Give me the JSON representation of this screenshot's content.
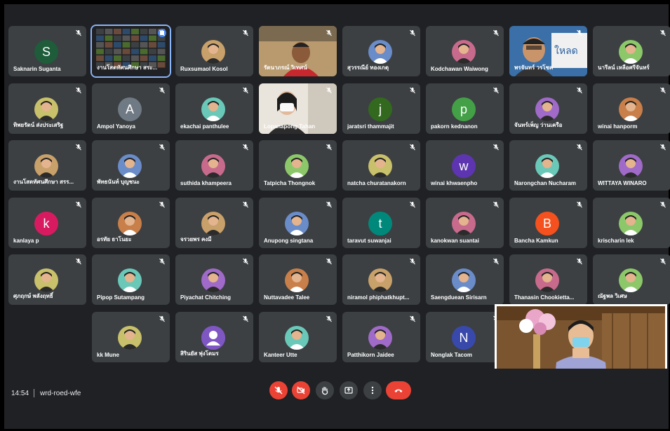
{
  "colors": {
    "background": "#202124",
    "tile": "#3c4043",
    "danger": "#ea4335",
    "active_border": "#8ab4f8"
  },
  "participants": [
    {
      "name": "Saknarin Suganta",
      "initial": "S",
      "avatar_color": "#1e5c3a"
    },
    {
      "name": "งานโสตทัศนศึกษา สระ...",
      "screen_share": true
    },
    {
      "name": "Ruxsumaol Kosol",
      "photo": true
    },
    {
      "name": "รัตนาภรณ์ วิเทศน์",
      "camera": true
    },
    {
      "name": "สุวรรณีย์ ทองเกตุ",
      "photo": true
    },
    {
      "name": "Kodchawan Waiwong",
      "photo": true
    },
    {
      "name": "พรจันทร์ วรโชค",
      "camera": true
    },
    {
      "name": "นารีลน์ เหลือศรีจันทร์",
      "photo": true
    },
    {
      "name": "ทิพยรัตน์ ส่งประเสริฐ",
      "photo": true
    },
    {
      "name": "Ampol Yanoya",
      "initial": "A",
      "avatar_color": "#6f7a84"
    },
    {
      "name": "ekachai panthulee",
      "photo": true
    },
    {
      "name": "Lopanapong Tahan",
      "camera": true
    },
    {
      "name": "jaratsri thammajit",
      "initial": "j",
      "avatar_color": "#33691e"
    },
    {
      "name": "pakorn kednanon",
      "initial": "p",
      "avatar_color": "#43a047"
    },
    {
      "name": "จันทร์เพ็ญ ว่านเครือ",
      "photo": true
    },
    {
      "name": "winai hanporm",
      "photo": true
    },
    {
      "name": "งานโสตทัศนศึกษา สรร...",
      "photo": true
    },
    {
      "name": "พัทธนันท์ บุญชนะ",
      "photo": true
    },
    {
      "name": "suthida khampeera",
      "photo": true
    },
    {
      "name": "Tatpicha Thongnok",
      "photo": true
    },
    {
      "name": "natcha churatanakorn",
      "photo": true
    },
    {
      "name": "winai khwaenpho",
      "initial": "w",
      "avatar_color": "#5e35b1"
    },
    {
      "name": "Narongchan Nucharam",
      "photo": true
    },
    {
      "name": "WITTAYA WINARO",
      "photo": true
    },
    {
      "name": "kanlaya p",
      "initial": "k",
      "avatar_color": "#d81b60"
    },
    {
      "name": "อรทัย ธาโนยะ",
      "photo": true
    },
    {
      "name": "จรวยพร คงมี",
      "photo": true
    },
    {
      "name": "Anupong singtana",
      "photo": true
    },
    {
      "name": "taravut suwanjai",
      "initial": "t",
      "avatar_color": "#00897b"
    },
    {
      "name": "kanokwan suantai",
      "photo": true
    },
    {
      "name": "Bancha Kamkun",
      "initial": "B",
      "avatar_color": "#f4511e"
    },
    {
      "name": "krischarin lek",
      "photo": true
    },
    {
      "name": "ศุภฤกษ์ พลังฤทธิ์",
      "photo": true
    },
    {
      "name": "Pipop Sutampang",
      "photo": true
    },
    {
      "name": "Piyachat Chitching",
      "photo": true
    },
    {
      "name": "Nuttavadee Talee",
      "photo": true
    },
    {
      "name": "niramol phiphatkhupt...",
      "photo": true
    },
    {
      "name": "Saengduean Sirisarn",
      "photo": true
    },
    {
      "name": "Thanasin Chookietta...",
      "photo": true
    },
    {
      "name": "ณัฐพล วิเศษ",
      "photo": true
    },
    {
      "name": "kk Mune",
      "photo": true
    },
    {
      "name": "สิรินยัส พุ่งโตมร",
      "initial": "",
      "avatar_color": "#7e57c2",
      "generic": true
    },
    {
      "name": "Kanteer Utte",
      "photo": true
    },
    {
      "name": "Patthikorn Jaidee",
      "photo": true
    },
    {
      "name": "Nonglak Tacom",
      "initial": "N",
      "avatar_color": "#3949ab"
    }
  ],
  "bottom_bar": {
    "time": "14:54",
    "meeting_code": "wrd-roed-wfe",
    "controls": [
      {
        "icon": "mic-off-icon",
        "color": "#ea4335"
      },
      {
        "icon": "camera-off-icon",
        "color": "#ea4335"
      },
      {
        "icon": "raise-hand-icon",
        "color": "#3c4043"
      },
      {
        "icon": "present-icon",
        "color": "#3c4043"
      },
      {
        "icon": "more-options-icon",
        "color": "#3c4043"
      },
      {
        "icon": "end-call-icon",
        "color": "#ea4335"
      }
    ]
  }
}
